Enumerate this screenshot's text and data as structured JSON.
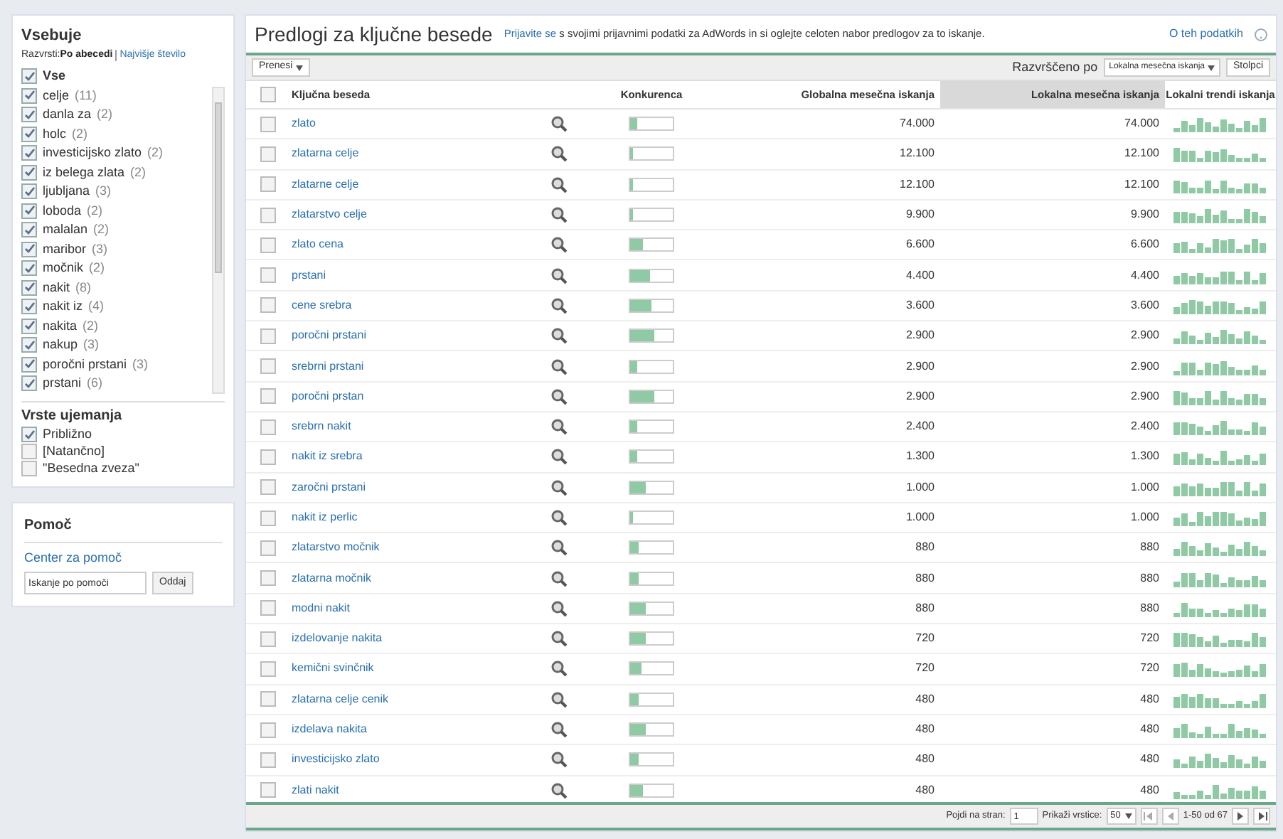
{
  "sidebar": {
    "contains": {
      "title": "Vsebuje",
      "sort_label": "Razvrsti:",
      "sort_options": [
        {
          "label": "Po abecedi",
          "selected": true
        },
        {
          "label": "Najvišje število",
          "selected": false
        }
      ],
      "all": {
        "label": "Vse",
        "checked": true
      },
      "items": [
        {
          "label": "celje",
          "count": "(11)",
          "checked": true
        },
        {
          "label": "danla za",
          "count": "(2)",
          "checked": true
        },
        {
          "label": "holc",
          "count": "(2)",
          "checked": true
        },
        {
          "label": "investicijsko zlato",
          "count": "(2)",
          "checked": true
        },
        {
          "label": "iz belega zlata",
          "count": "(2)",
          "checked": true
        },
        {
          "label": "ljubljana",
          "count": "(3)",
          "checked": true
        },
        {
          "label": "loboda",
          "count": "(2)",
          "checked": true
        },
        {
          "label": "malalan",
          "count": "(2)",
          "checked": true
        },
        {
          "label": "maribor",
          "count": "(3)",
          "checked": true
        },
        {
          "label": "močnik",
          "count": "(2)",
          "checked": true
        },
        {
          "label": "nakit",
          "count": "(8)",
          "checked": true
        },
        {
          "label": "nakit iz",
          "count": "(4)",
          "checked": true
        },
        {
          "label": "nakita",
          "count": "(2)",
          "checked": true
        },
        {
          "label": "nakup",
          "count": "(3)",
          "checked": true
        },
        {
          "label": "poročni prstani",
          "count": "(3)",
          "checked": true
        },
        {
          "label": "prstani",
          "count": "(6)",
          "checked": true
        }
      ]
    },
    "match_types": {
      "title": "Vrste ujemanja",
      "items": [
        {
          "label": "Približno",
          "checked": true
        },
        {
          "label": "[Natančno]",
          "checked": false
        },
        {
          "label": "\"Besedna zveza\"",
          "checked": false
        }
      ]
    },
    "help": {
      "title": "Pomoč",
      "link": "Center za pomoč",
      "search_value": "Iskanje po pomoči",
      "submit": "Oddaj"
    }
  },
  "main": {
    "title": "Predlogi za ključne besede",
    "notice_link": "Prijavite se",
    "notice": "s svojimi prijavnimi podatki za AdWords in si oglejte celoten nabor predlogov za to iskanje.",
    "about_link": "O teh podatkih",
    "toolbar": {
      "download": "Prenesi",
      "sorted_by_label": "Razvrščeno po",
      "sorted_by_value": "Lokalna mesečna iskanja",
      "columns_button": "Stolpci"
    },
    "table": {
      "select_all_checked": false,
      "columns": [
        {
          "label": "Ključna beseda",
          "sorted": false
        },
        {
          "label": "Konkurenca",
          "sorted": false
        },
        {
          "label": "Globalna mesečna iskanja",
          "sorted": false
        },
        {
          "label": "Lokalna mesečna iskanja",
          "sorted": true
        },
        {
          "label": "Lokalni trendi iskanja",
          "sorted": false
        }
      ],
      "rows": [
        {
          "keyword": "zlato",
          "level": 0.15,
          "global": "74.000",
          "local": "74.000",
          "checked": false
        },
        {
          "keyword": "zlatarna celje",
          "level": 0.08,
          "global": "12.100",
          "local": "12.100",
          "checked": false
        },
        {
          "keyword": "zlatarne celje",
          "level": 0.08,
          "global": "12.100",
          "local": "12.100",
          "checked": false
        },
        {
          "keyword": "zlatarstvo celje",
          "level": 0.08,
          "global": "9.900",
          "local": "9.900",
          "checked": false
        },
        {
          "keyword": "zlato cena",
          "level": 0.3,
          "global": "6.600",
          "local": "6.600",
          "checked": false
        },
        {
          "keyword": "prstani",
          "level": 0.45,
          "global": "4.400",
          "local": "4.400",
          "checked": false
        },
        {
          "keyword": "cene srebra",
          "level": 0.5,
          "global": "3.600",
          "local": "3.600",
          "checked": false
        },
        {
          "keyword": "poročni prstani",
          "level": 0.55,
          "global": "2.900",
          "local": "2.900",
          "checked": false
        },
        {
          "keyword": "srebrni prstani",
          "level": 0.15,
          "global": "2.900",
          "local": "2.900",
          "checked": false
        },
        {
          "keyword": "poročni prstan",
          "level": 0.55,
          "global": "2.900",
          "local": "2.900",
          "checked": false
        },
        {
          "keyword": "srebrn nakit",
          "level": 0.18,
          "global": "2.400",
          "local": "2.400",
          "checked": false
        },
        {
          "keyword": "nakit iz srebra",
          "level": 0.15,
          "global": "1.300",
          "local": "1.300",
          "checked": false
        },
        {
          "keyword": "zaročni prstani",
          "level": 0.35,
          "global": "1.000",
          "local": "1.000",
          "checked": false
        },
        {
          "keyword": "nakit iz perlic",
          "level": 0.08,
          "global": "1.000",
          "local": "1.000",
          "checked": false
        },
        {
          "keyword": "zlatarstvo močnik",
          "level": 0.2,
          "global": "880",
          "local": "880",
          "checked": false
        },
        {
          "keyword": "zlatarna močnik",
          "level": 0.2,
          "global": "880",
          "local": "880",
          "checked": false
        },
        {
          "keyword": "modni nakit",
          "level": 0.35,
          "global": "880",
          "local": "880",
          "checked": false
        },
        {
          "keyword": "izdelovanje nakita",
          "level": 0.35,
          "global": "720",
          "local": "720",
          "checked": false
        },
        {
          "keyword": "kemični svinčnik",
          "level": 0.28,
          "global": "720",
          "local": "720",
          "checked": false
        },
        {
          "keyword": "zlatarna celje cenik",
          "level": 0.2,
          "global": "480",
          "local": "480",
          "checked": false
        },
        {
          "keyword": "izdelava nakita",
          "level": 0.35,
          "global": "480",
          "local": "480",
          "checked": false
        },
        {
          "keyword": "investicijsko zlato",
          "level": 0.2,
          "global": "480",
          "local": "480",
          "checked": false
        },
        {
          "keyword": "zlati nakit",
          "level": 0.3,
          "global": "480",
          "local": "480",
          "checked": false
        }
      ]
    },
    "pager": {
      "page_label": "Pojdi na stran:",
      "page_value": "1",
      "rows_label": "Prikaži vrstice:",
      "rows_value": "50",
      "range": "1-50 od 67"
    }
  }
}
